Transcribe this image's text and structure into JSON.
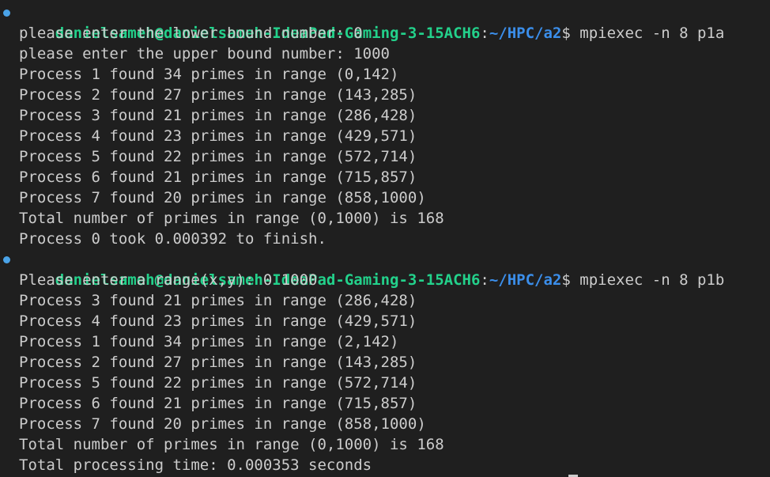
{
  "session1": {
    "user": "danielsameh@danielsameh-IdeaPad-Gaming-3-15ACH6",
    "colon": ":",
    "path": "~/HPC/a2",
    "dollar": "$",
    "command": " mpiexec -n 8 p1a",
    "output": [
      "please enter the lower bound number: 0",
      "please enter the upper bound number: 1000",
      "Process 1 found 34 primes in range (0,142)",
      "Process 2 found 27 primes in range (143,285)",
      "Process 3 found 21 primes in range (286,428)",
      "Process 4 found 23 primes in range (429,571)",
      "Process 5 found 22 primes in range (572,714)",
      "Process 6 found 21 primes in range (715,857)",
      "Process 7 found 20 primes in range (858,1000)",
      "Total number of primes in range (0,1000) is 168",
      "Process 0 took 0.000392 to finish."
    ]
  },
  "session2": {
    "user": "danielsameh@danielsameh-IdeaPad-Gaming-3-15ACH6",
    "colon": ":",
    "path": "~/HPC/a2",
    "dollar": "$",
    "command": " mpiexec -n 8 p1b",
    "output": [
      "Please enter a range(x,y): 0 1000",
      "Process 3 found 21 primes in range (286,428)",
      "Process 4 found 23 primes in range (429,571)",
      "Process 1 found 34 primes in range (2,142)",
      "Process 2 found 27 primes in range (143,285)",
      "Process 5 found 22 primes in range (572,714)",
      "Process 6 found 21 primes in range (715,857)",
      "Process 7 found 20 primes in range (858,1000)",
      "Total number of primes in range (0,1000) is 168",
      "Total processing time: 0.000353 seconds"
    ]
  },
  "colors": {
    "background": "#1f1f1f",
    "user": "#23d18b",
    "path": "#3b8eea",
    "text": "#cccccc",
    "decoration_dot": "#4aa3e8"
  }
}
